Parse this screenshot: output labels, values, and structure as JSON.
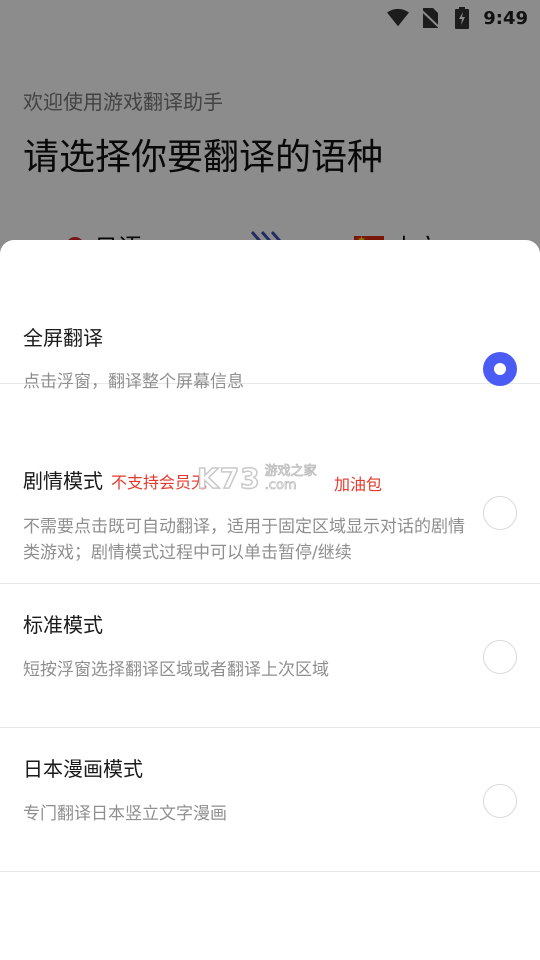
{
  "status_bar": {
    "time": "9:49"
  },
  "background": {
    "welcome": "欢迎使用游戏翻译助手",
    "heading": "请选择你要翻译的语种",
    "source_lang": "日语",
    "target_lang": "中文"
  },
  "options": [
    {
      "title": "全屏翻译",
      "tag": "",
      "desc": "点击浮窗，翻译整个屏幕信息",
      "selected": true
    },
    {
      "title": "剧情模式",
      "tag": "不支持会员无限使用，需购买加油包",
      "tag_visible_left": "不支持会员无",
      "tag_visible_right": "加油包",
      "desc": "不需要点击既可自动翻译，适用于固定区域显示对话的剧情类游戏；剧情模式过程中可以单击暂停/继续",
      "selected": false
    },
    {
      "title": "标准模式",
      "tag": "",
      "desc": "短按浮窗选择翻译区域或者翻译上次区域",
      "selected": false
    },
    {
      "title": "日本漫画模式",
      "tag": "",
      "desc": "专门翻译日本竖立文字漫画",
      "selected": false
    }
  ],
  "watermark": {
    "logo": "K73",
    "site": "游戏之家",
    "domain": ".com"
  },
  "colors": {
    "accent": "#4b5cf5",
    "tag_red": "#e5382b",
    "scrim": "rgba(0,0,0,0.45)"
  },
  "icons": [
    "wifi-icon",
    "no-sim-icon",
    "battery-charging-icon",
    "swap-arrows-icon"
  ]
}
